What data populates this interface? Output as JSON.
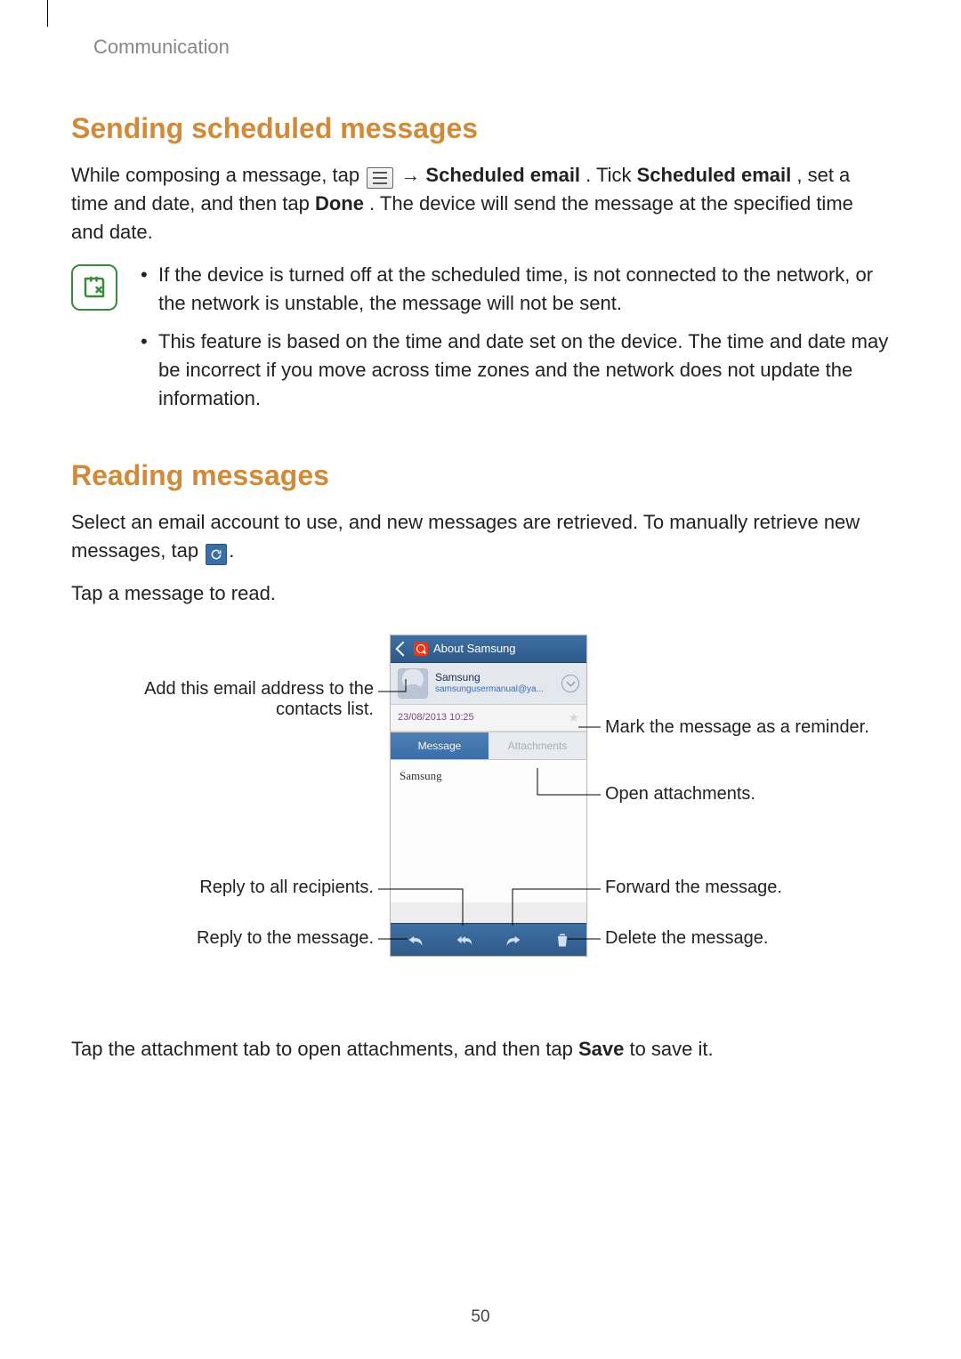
{
  "running_header": "Communication",
  "page_number": "50",
  "section1": {
    "heading": "Sending scheduled messages",
    "para": {
      "pre": "While composing a message, tap ",
      "arrow": " → ",
      "b1": "Scheduled email",
      "mid1": ". Tick ",
      "b2": "Scheduled email",
      "mid2": ", set a time and date, and then tap ",
      "b3": "Done",
      "post": ". The device will send the message at the specified time and date."
    },
    "notes": [
      "If the device is turned off at the scheduled time, is not connected to the network, or the network is unstable, the message will not be sent.",
      "This feature is based on the time and date set on the device. The time and date may be incorrect if you move across time zones and the network does not update the information."
    ]
  },
  "section2": {
    "heading": "Reading messages",
    "para": {
      "pre": "Select an email account to use, and new messages are retrieved. To manually retrieve new messages, tap ",
      "post": "."
    },
    "para2": "Tap a message to read.",
    "para3": {
      "pre": "Tap the attachment tab to open attachments, and then tap ",
      "b1": "Save",
      "post": " to save it."
    }
  },
  "phone": {
    "title": "About Samsung",
    "sender_name": "Samsung",
    "sender_email": "samsungusermanual@ya...",
    "datetime": "23/08/2013  10:25",
    "tab_message": "Message",
    "tab_attachments": "Attachments",
    "body": "Samsung"
  },
  "callouts": {
    "add_contact_l1": "Add this email address to the",
    "add_contact_l2": "contacts list.",
    "reply_all": "Reply to all recipients.",
    "reply": "Reply to the message.",
    "mark_reminder": "Mark the message as a reminder.",
    "open_attach": "Open attachments.",
    "forward": "Forward the message.",
    "delete": "Delete the message."
  }
}
